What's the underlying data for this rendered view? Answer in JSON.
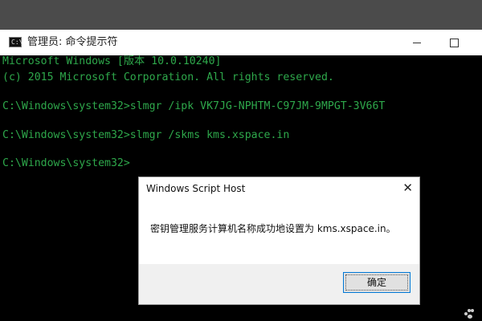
{
  "window": {
    "title": "管理员: 命令提示符",
    "icon_text": "C:\\",
    "controls": {
      "minimize": "minimize-icon",
      "maximize": "maximize-icon",
      "close": "close-icon"
    }
  },
  "console": {
    "text_color": "#2ea84b",
    "background": "#000000",
    "lines": [
      "Microsoft Windows [版本 10.0.10240]",
      "(c) 2015 Microsoft Corporation. All rights reserved.",
      "",
      "C:\\Windows\\system32>slmgr /ipk VK7JG-NPHTM-C97JM-9MPGT-3V66T",
      "",
      "C:\\Windows\\system32>slmgr /skms kms.xspace.in",
      "",
      "C:\\Windows\\system32>"
    ]
  },
  "dialog": {
    "title": "Windows Script Host",
    "message": "密钥管理服务计算机名称成功地设置为 kms.xspace.in。",
    "ok_label": "确定",
    "close_glyph": "✕"
  }
}
